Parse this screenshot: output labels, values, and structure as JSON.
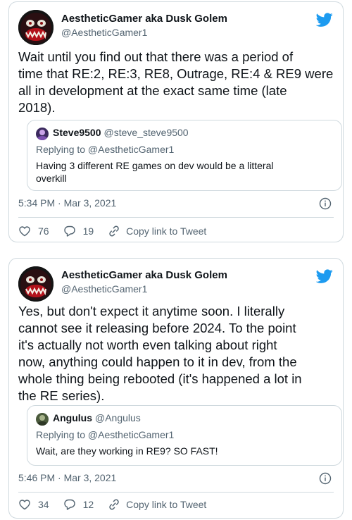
{
  "tweets": [
    {
      "author": {
        "name": "AestheticGamer aka Dusk Golem",
        "handle": "@AestheticGamer1"
      },
      "text_lines": [
        "Wait until you find out that there was a period of",
        "time that RE:2, RE:3, RE8, Outrage, RE:4 & RE9 were",
        "all in development at the exact same time (late",
        "2018)."
      ],
      "quote": {
        "name": "Steve9500",
        "handle": "@steve_steve9500",
        "replying_to": "Replying to @AestheticGamer1",
        "text_lines": [
          "Having 3 different RE games on dev would be a litteral",
          "overkill"
        ]
      },
      "timestamp": "5:34 PM · Mar 3, 2021",
      "likes": "76",
      "replies": "19",
      "copy_link_label": "Copy link to Tweet"
    },
    {
      "author": {
        "name": "AestheticGamer aka Dusk Golem",
        "handle": "@AestheticGamer1"
      },
      "text_lines": [
        "Yes, but don't expect it anytime soon. I literally",
        "cannot see it releasing before 2024. To the point",
        "it's actually not worth even talking about right",
        "now, anything could happen to it in dev, from the",
        "whole thing being rebooted (it's happened a lot in",
        "the RE series)."
      ],
      "quote": {
        "name": "Angulus",
        "handle": "@Angulus",
        "replying_to": "Replying to @AestheticGamer1",
        "text_lines": [
          "Wait, are they working in RE9? SO FAST!"
        ]
      },
      "timestamp": "5:46 PM · Mar 3, 2021",
      "likes": "34",
      "replies": "12",
      "copy_link_label": "Copy link to Tweet"
    }
  ],
  "icons": {
    "brand": "twitter-bird-icon",
    "like": "heart-icon",
    "reply": "reply-bubble-icon",
    "copy": "link-icon",
    "info": "info-icon"
  },
  "colors": {
    "brand_blue": "#1d9bf0",
    "muted": "#536471",
    "border": "#cfd9de",
    "text": "#0f1419"
  }
}
